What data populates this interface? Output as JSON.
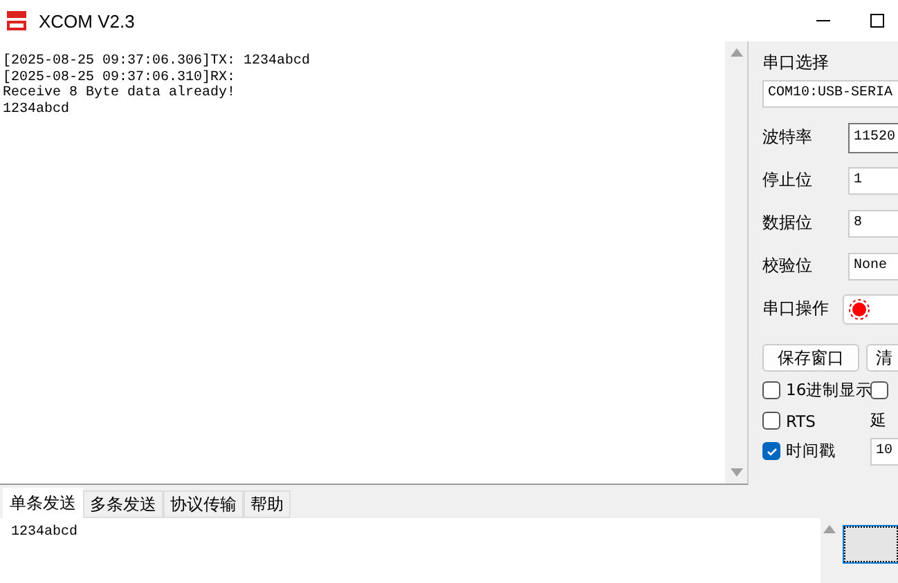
{
  "window": {
    "title": "XCOM V2.3"
  },
  "receive_log": [
    "[2025-08-25 09:37:06.306]TX: 1234abcd",
    "[2025-08-25 09:37:06.310]RX:",
    "Receive 8 Byte data already!",
    "1234abcd"
  ],
  "serial_panel": {
    "port_label": "串口选择",
    "port": "COM10:USB-SERIA",
    "settings": [
      {
        "label": "波特率",
        "value": "11520"
      },
      {
        "label": "停止位",
        "value": "1"
      },
      {
        "label": "数据位",
        "value": "8"
      },
      {
        "label": "校验位",
        "value": "None"
      }
    ],
    "operation_label": "串口操作",
    "port_open": true,
    "buttons": [
      "保存窗口",
      "清"
    ],
    "options": [
      {
        "kind": "checkbox",
        "label": "16进制显示",
        "checked": false
      },
      {
        "kind": "checkbox",
        "checked": false
      },
      {
        "kind": "checkbox",
        "label": "RTS",
        "checked": false
      },
      {
        "kind": "label",
        "label": "延"
      },
      {
        "kind": "checkbox",
        "label": "时间戳",
        "checked": true
      },
      {
        "kind": "field",
        "value": "10"
      }
    ]
  },
  "tabs": [
    {
      "label": "单条发送",
      "selected": true
    },
    {
      "label": "多条发送",
      "selected": false
    },
    {
      "label": "协议传输",
      "selected": false
    },
    {
      "label": "帮助",
      "selected": false
    }
  ],
  "send_text": "1234abcd"
}
